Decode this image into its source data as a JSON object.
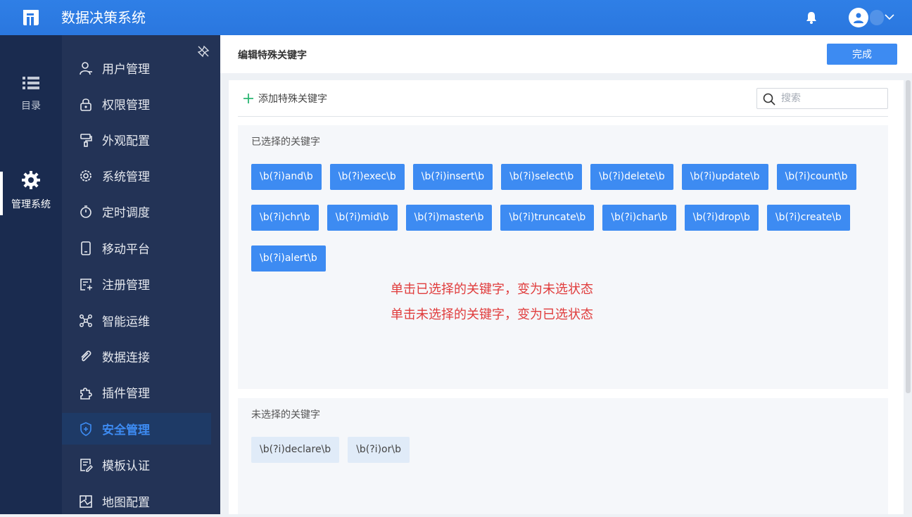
{
  "app": {
    "title": "数据决策系统"
  },
  "rail": {
    "items": [
      {
        "label": "目录",
        "icon": "list-icon"
      },
      {
        "label": "管理系统",
        "icon": "gear-icon",
        "active": true
      }
    ]
  },
  "sidebar": {
    "items": [
      {
        "label": "用户管理",
        "icon": "user-icon"
      },
      {
        "label": "权限管理",
        "icon": "lock-icon"
      },
      {
        "label": "外观配置",
        "icon": "paint-roller-icon"
      },
      {
        "label": "系统管理",
        "icon": "cog-icon"
      },
      {
        "label": "定时调度",
        "icon": "stopwatch-icon"
      },
      {
        "label": "移动平台",
        "icon": "mobile-icon"
      },
      {
        "label": "注册管理",
        "icon": "register-icon"
      },
      {
        "label": "智能运维",
        "icon": "network-icon"
      },
      {
        "label": "数据连接",
        "icon": "paperclip-icon"
      },
      {
        "label": "插件管理",
        "icon": "puzzle-icon"
      },
      {
        "label": "安全管理",
        "icon": "shield-icon",
        "active": true
      },
      {
        "label": "模板认证",
        "icon": "document-edit-icon"
      },
      {
        "label": "地图配置",
        "icon": "map-icon"
      }
    ]
  },
  "header": {
    "title": "编辑特殊关键字",
    "done_label": "完成"
  },
  "toolbar": {
    "add_label": "添加特殊关键字",
    "search_placeholder": "搜索"
  },
  "selected": {
    "title": "已选择的关键字",
    "keywords": [
      "\\b(?i)and\\b",
      "\\b(?i)exec\\b",
      "\\b(?i)insert\\b",
      "\\b(?i)select\\b",
      "\\b(?i)delete\\b",
      "\\b(?i)update\\b",
      "\\b(?i)count\\b",
      "\\b(?i)chr\\b",
      "\\b(?i)mid\\b",
      "\\b(?i)master\\b",
      "\\b(?i)truncate\\b",
      "\\b(?i)char\\b",
      "\\b(?i)drop\\b",
      "\\b(?i)create\\b",
      "\\b(?i)alert\\b"
    ]
  },
  "unselected": {
    "title": "未选择的关键字",
    "keywords": [
      "\\b(?i)declare\\b",
      "\\b(?i)or\\b"
    ]
  },
  "hints": {
    "line1": "单击已选择的关键字，变为未选状态",
    "line2": "单击未选择的关键字，变为已选状态"
  },
  "colors": {
    "topbar": "#2c7be5",
    "rail": "#1a2b4f",
    "sidebar": "#233356",
    "accent": "#3d8bf2",
    "hint": "#e03c3c"
  }
}
